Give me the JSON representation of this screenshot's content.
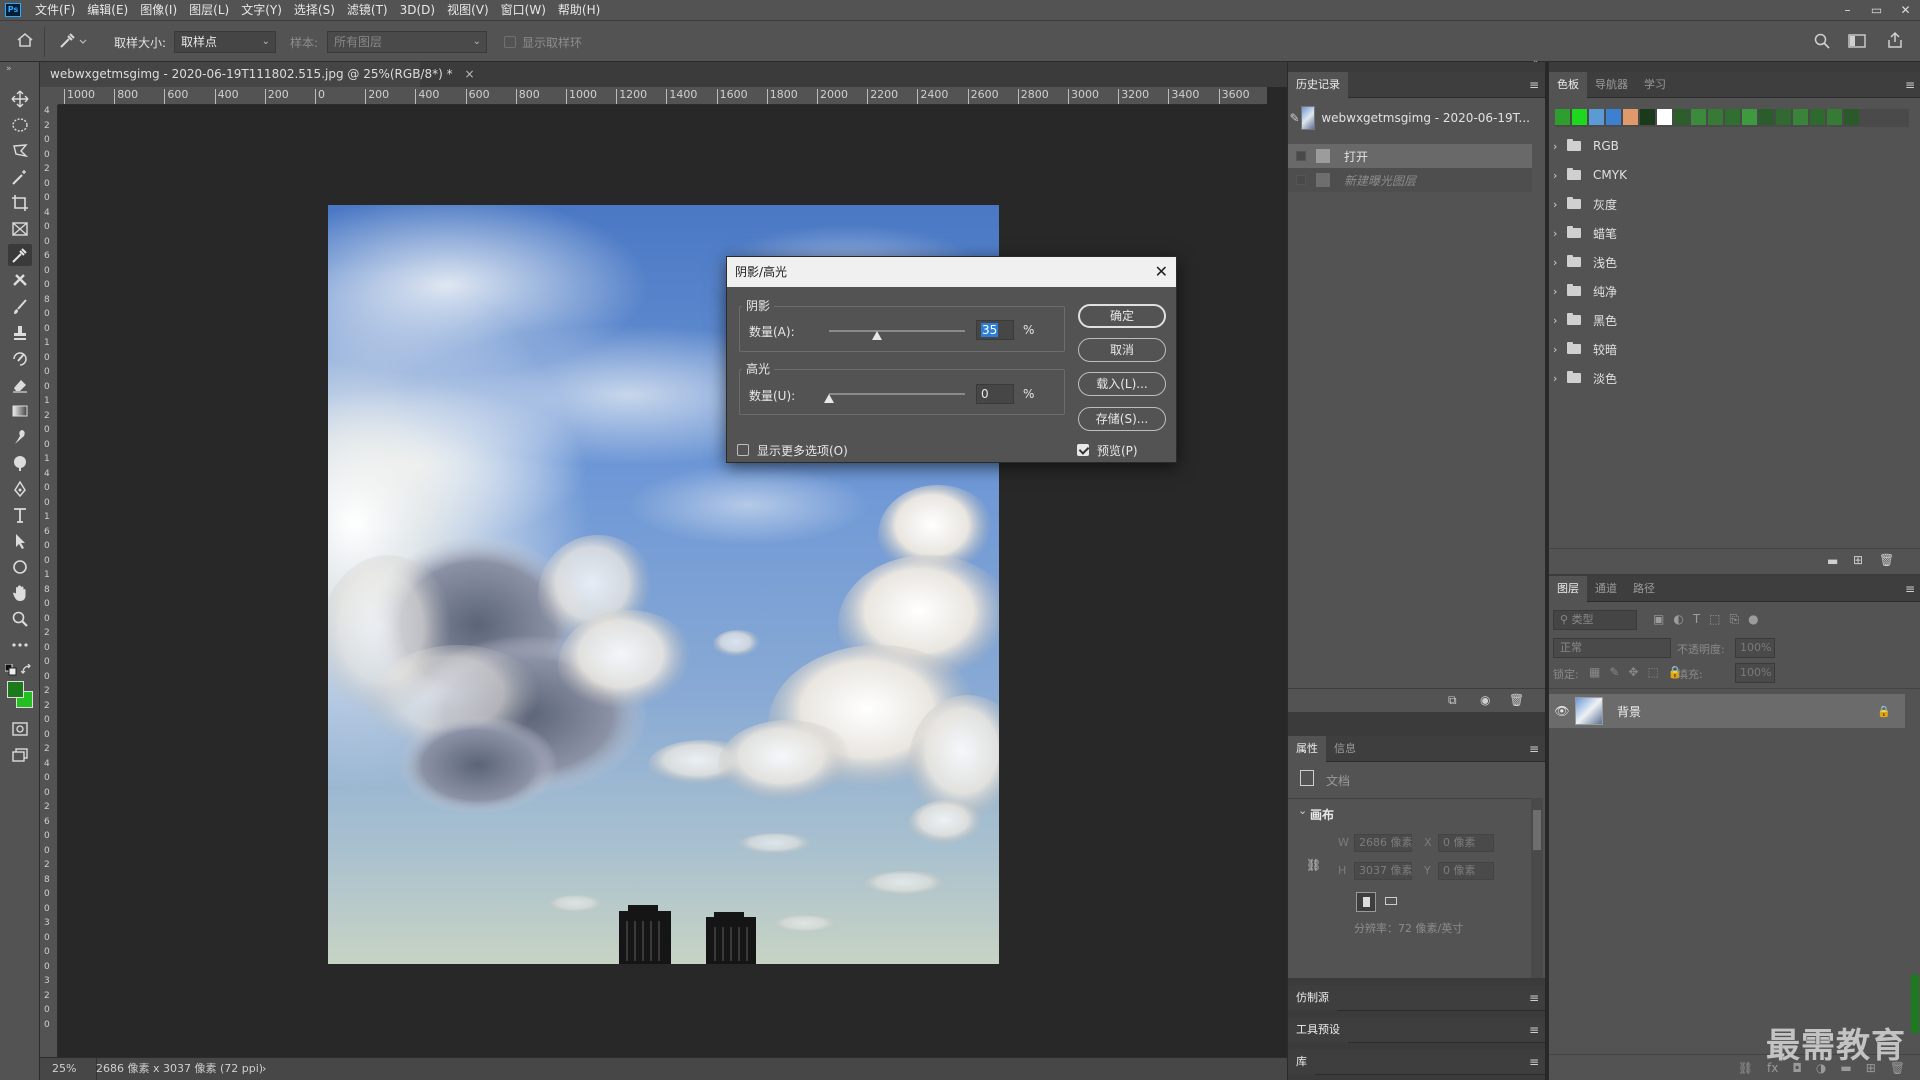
{
  "app": {
    "logo": "Ps"
  },
  "menu": [
    "文件(F)",
    "编辑(E)",
    "图像(I)",
    "图层(L)",
    "文字(Y)",
    "选择(S)",
    "滤镜(T)",
    "3D(D)",
    "视图(V)",
    "窗口(W)",
    "帮助(H)"
  ],
  "window_controls": {
    "minimize": "–",
    "restore": "▭",
    "close": "✕"
  },
  "options_bar": {
    "sample_size_label": "取样大小:",
    "sample_size_value": "取样点",
    "sample_label": "样本:",
    "sample_value": "所有图层",
    "show_ring_label": "显示取样环"
  },
  "document": {
    "tab_title": "webwxgetmsgimg - 2020-06-19T111802.515.jpg @ 25%(RGB/8*) *",
    "tab_close": "×",
    "h_ruler": [
      "1000",
      "800",
      "600",
      "400",
      "200",
      "0",
      "200",
      "400",
      "600",
      "800",
      "1000",
      "1200",
      "1400",
      "1600",
      "1800",
      "2000",
      "2200",
      "2400",
      "2600",
      "2800",
      "3000",
      "3200",
      "3400",
      "3600"
    ],
    "v_ruler": [
      "4",
      "2",
      "0",
      "0",
      "2",
      "0",
      "0",
      "4",
      "0",
      "0",
      "6",
      "0",
      "0",
      "8",
      "0",
      "0",
      "1",
      "0",
      "0",
      "0",
      "1",
      "2",
      "0",
      "0",
      "1",
      "4",
      "0",
      "0",
      "1",
      "6",
      "0",
      "0",
      "1",
      "8",
      "0",
      "0",
      "2",
      "0",
      "0",
      "0",
      "2",
      "2",
      "0",
      "0",
      "2",
      "4",
      "0",
      "0",
      "2",
      "6",
      "0",
      "0",
      "2",
      "8",
      "0",
      "0",
      "3",
      "0",
      "0",
      "0",
      "3",
      "2",
      "0",
      "0"
    ]
  },
  "status": {
    "zoom": "25%",
    "info": "2686 像素 x 3037 像素 (72 ppi)",
    "arrow": "›"
  },
  "history_panel": {
    "tab": "历史记录",
    "snapshot": "webwxgetmsgimg - 2020-06-19T...",
    "items": [
      {
        "label": "打开",
        "state": "active"
      },
      {
        "label": "新建曝光图层",
        "state": "dimmed"
      }
    ]
  },
  "swatches_panel": {
    "tabs": [
      "色板",
      "导航器",
      "学习"
    ],
    "colors": [
      "#2e9e2e",
      "#1ed81e",
      "#5b9bd5",
      "#3d7fd0",
      "#e0996a",
      "#1b3a1b",
      "#ffffff",
      "#2c5e2c",
      "#3c8a3c",
      "#367a36",
      "#2f6f2f",
      "#3e9a3e",
      "#2b5c2b",
      "#306a30",
      "#3a843a",
      "#2e6a2e",
      "#357a35",
      "#2a5a2a"
    ],
    "folders": [
      "RGB",
      "CMYK",
      "灰度",
      "蜡笔",
      "浅色",
      "纯净",
      "黑色",
      "较暗",
      "淡色"
    ]
  },
  "properties_panel": {
    "tabs": [
      "属性",
      "信息"
    ],
    "doc_label": "文档",
    "section": "画布",
    "w_label": "W",
    "w_value": "2686 像素",
    "h_label": "H",
    "h_value": "3037 像素",
    "x_label": "X",
    "x_value": "0 像素",
    "y_label": "Y",
    "y_value": "0 像素",
    "resolution": "分辨率：72 像素/英寸"
  },
  "collapsed_panels": [
    "仿制源",
    "工具预设",
    "库"
  ],
  "layers_panel": {
    "tabs": [
      "图层",
      "通道",
      "路径"
    ],
    "filter_placeholder": "类型",
    "blend_mode": "正常",
    "opacity_label": "不透明度:",
    "opacity_value": "100%",
    "lock_label": "锁定:",
    "fill_label": "填充:",
    "fill_value": "100%",
    "layer_name": "背景"
  },
  "dialog": {
    "title": "阴影/高光",
    "close": "✕",
    "shadows_group": "阴影",
    "shadows_amount_label": "数量(A):",
    "shadows_amount_value": "35",
    "shadows_amount_percent": 35,
    "highlights_group": "高光",
    "highlights_amount_label": "数量(U):",
    "highlights_amount_value": "0",
    "highlights_amount_percent": 0,
    "percent": "%",
    "ok": "确定",
    "cancel": "取消",
    "load": "载入(L)...",
    "save": "存储(S)...",
    "more_options": "显示更多选项(O)",
    "more_options_checked": false,
    "preview": "预览(P)",
    "preview_checked": true
  },
  "watermark": "最需教育"
}
